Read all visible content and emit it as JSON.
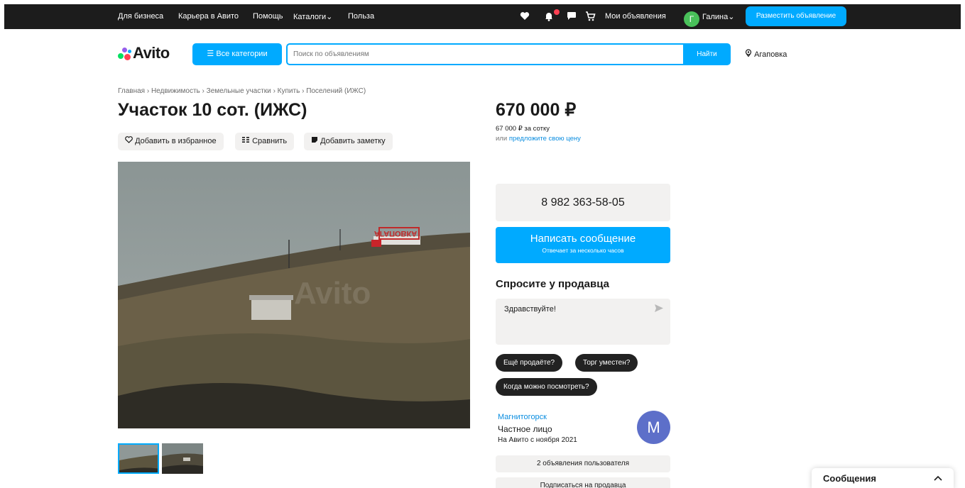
{
  "topbar": {
    "links": [
      "Для бизнеса",
      "Карьера в Авито",
      "Помощь",
      "Каталоги",
      "Польза"
    ],
    "catalog_caret": "⌄",
    "icons": [
      "heart-icon",
      "bell-icon",
      "chat-icon",
      "cart-icon"
    ],
    "my_ads": "Мои объявления",
    "user_initial": "Г",
    "user_name": "Галина",
    "user_caret": "⌄",
    "post_button": "Разместить объявление"
  },
  "header": {
    "logo": "Avito",
    "categories_button": "Все категории",
    "search_placeholder": "Поиск по объявлениям",
    "find_button": "Найти",
    "location": "Агаповка"
  },
  "breadcrumb": [
    "Главная",
    "Недвижимость",
    "Земельные участки",
    "Купить",
    "Поселений (ИЖС)"
  ],
  "listing": {
    "title": "Участок 10 сот. (ИЖС)",
    "actions": {
      "favorite": "Добавить в избранное",
      "compare": "Сравнить",
      "note": "Добавить заметку"
    },
    "photo_sign": "АГАПОВКА",
    "price": "670 000 ₽",
    "price_per": "67 000 ₽ за сотку",
    "offer_prefix": "или",
    "offer_link": "предложите свою цену"
  },
  "contact": {
    "phone": "8 982 363-58-05",
    "message_button": "Написать сообщение",
    "message_sub": "Отвечает за несколько часов",
    "ask_heading": "Спросите у продавца",
    "ask_text": "Здравствуйте!",
    "chips": [
      "Ещё продаёте?",
      "Торг уместен?",
      "Когда можно посмотреть?"
    ]
  },
  "seller": {
    "city": "Магнитогорск",
    "type": "Частное лицо",
    "since": "На Авито с ноября 2021",
    "initial": "М",
    "ads_button": "2 объявления пользователя",
    "subscribe_button": "Подписаться на продавца"
  },
  "messenger": {
    "label": "Сообщения"
  },
  "colors": {
    "accent": "#00aaff",
    "link": "#0a8de0",
    "topbar": "#1c1c1c",
    "chip": "#222222",
    "muted_bg": "#f2f1f0"
  }
}
